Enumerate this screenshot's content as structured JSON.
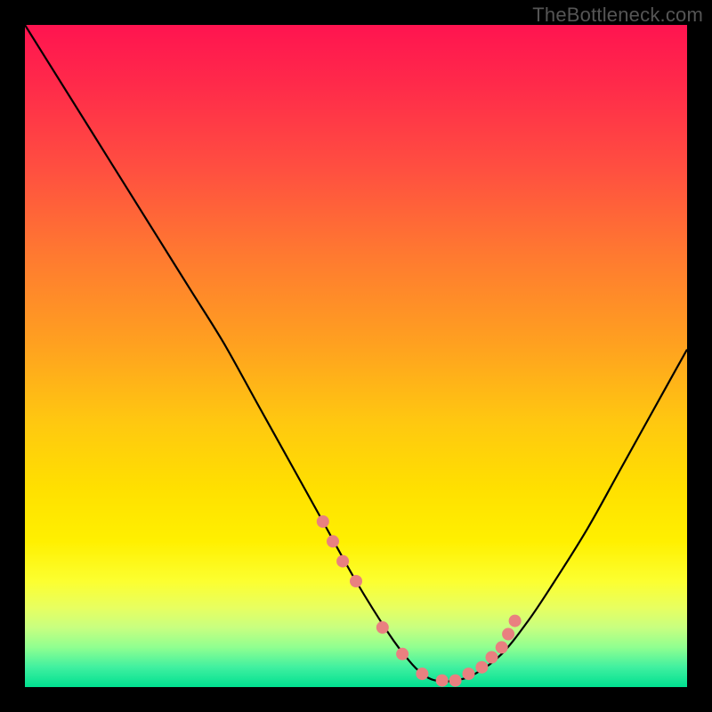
{
  "watermark": "TheBottleneck.com",
  "chart_data": {
    "type": "line",
    "title": "",
    "xlabel": "",
    "ylabel": "",
    "xlim": [
      0,
      100
    ],
    "ylim": [
      0,
      100
    ],
    "series": [
      {
        "name": "bottleneck-curve",
        "color": "#000000",
        "x": [
          0,
          5,
          10,
          15,
          20,
          25,
          30,
          35,
          40,
          45,
          50,
          55,
          58,
          60,
          62,
          65,
          68,
          72,
          76,
          80,
          85,
          90,
          95,
          100
        ],
        "y": [
          100,
          92,
          84,
          76,
          68,
          60,
          52,
          43,
          34,
          25,
          16,
          8,
          4,
          2,
          1,
          1,
          2,
          5,
          10,
          16,
          24,
          33,
          42,
          51
        ]
      }
    ],
    "markers": {
      "name": "highlight-dots",
      "color": "#e98080",
      "radius": 7,
      "x": [
        45,
        46.5,
        48,
        50,
        54,
        57,
        60,
        63,
        65,
        67,
        69,
        70.5,
        72,
        73,
        74
      ],
      "y": [
        25,
        22,
        19,
        16,
        9,
        5,
        2,
        1,
        1,
        2,
        3,
        4.5,
        6,
        8,
        10
      ]
    },
    "background_gradient": {
      "top": "#ff1450",
      "bottom": "#00e090"
    }
  }
}
